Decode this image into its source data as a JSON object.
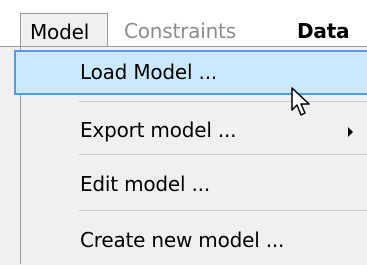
{
  "menubar": {
    "items": [
      {
        "label": "Model",
        "state": "open"
      },
      {
        "label": "Constraints",
        "state": "disabled"
      },
      {
        "label": "Data",
        "state": "normal"
      }
    ]
  },
  "dropdown": {
    "items": [
      {
        "label": "Load Model ...",
        "state": "hovered",
        "has_submenu": false
      },
      {
        "label": "Export model ...",
        "state": "normal",
        "has_submenu": true
      },
      {
        "label": "Edit model ...",
        "state": "normal",
        "has_submenu": false
      },
      {
        "label": "Create new model ...",
        "state": "normal",
        "has_submenu": false
      }
    ]
  },
  "colors": {
    "hover_fill": "#cce8ff",
    "hover_border": "#4d9de6",
    "menu_background": "#f0f0f0",
    "disabled_text": "#8c8c8c"
  },
  "icons": {
    "submenu": "chevron-right-icon",
    "pointer": "mouse-pointer-icon"
  }
}
